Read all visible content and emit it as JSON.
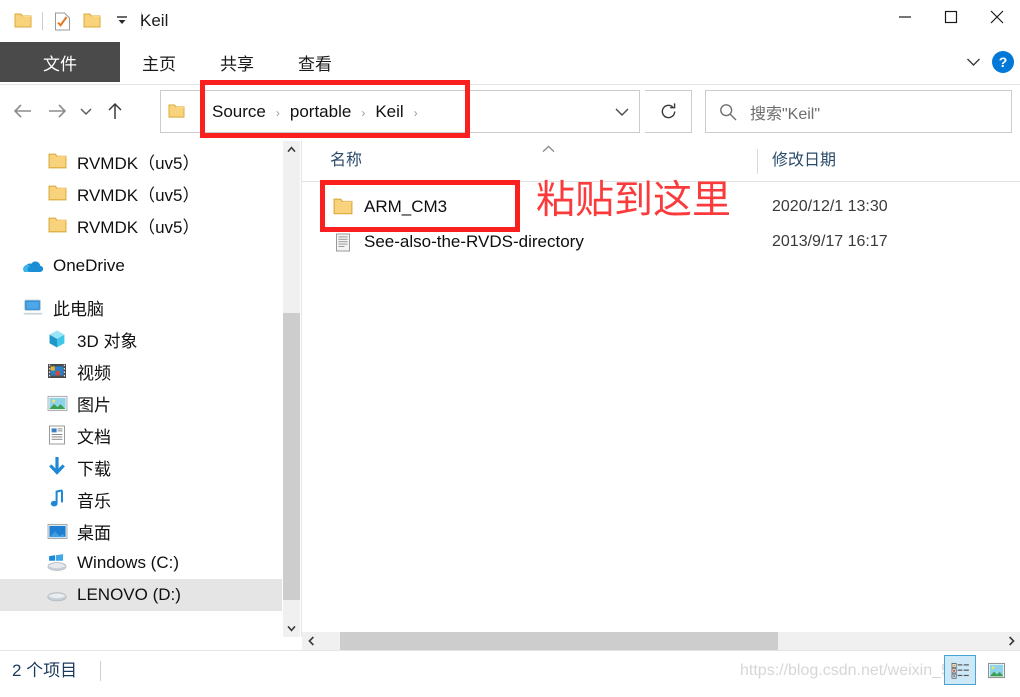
{
  "window": {
    "title": "Keil",
    "quick_access": [
      {
        "name": "folder-icon",
        "label": "文件夹"
      },
      {
        "name": "properties-icon",
        "label": "属性"
      },
      {
        "name": "new-folder-icon",
        "label": "新建文件夹"
      },
      {
        "name": "customize-dropdown-icon",
        "label": "自定义快速访问工具栏"
      }
    ],
    "controls": {
      "minimize": "最小化",
      "maximize": "最大化",
      "close": "关闭"
    }
  },
  "ribbon": {
    "tabs": [
      {
        "label": "文件",
        "active": true
      },
      {
        "label": "主页",
        "active": false
      },
      {
        "label": "共享",
        "active": false
      },
      {
        "label": "查看",
        "active": false
      }
    ],
    "expand_label": "展开功能区",
    "help_label": "?"
  },
  "navbar": {
    "back": "后退",
    "forward": "前进",
    "recent": "最近浏览的位置",
    "up": "上移到",
    "breadcrumbs": [
      "Source",
      "portable",
      "Keil"
    ],
    "breadcrumb_sep": "›",
    "dropdown": "上一个位置",
    "refresh": "刷新"
  },
  "search": {
    "placeholder": "搜索\"Keil\"",
    "icon": "search-icon"
  },
  "sidebar": {
    "items": [
      {
        "label": "RVMDK（uv5）",
        "icon": "folder-icon",
        "level": 3,
        "highlight": false
      },
      {
        "label": "RVMDK（uv5）",
        "icon": "folder-icon",
        "level": 3,
        "highlight": false
      },
      {
        "label": "RVMDK（uv5）",
        "icon": "folder-icon",
        "level": 3,
        "highlight": false
      },
      {
        "label": "OneDrive",
        "icon": "onedrive-icon",
        "level": 1,
        "highlight": false
      },
      {
        "label": "此电脑",
        "icon": "this-pc-icon",
        "level": 1,
        "highlight": false
      },
      {
        "label": "3D 对象",
        "icon": "3d-objects-icon",
        "level": 2,
        "highlight": false
      },
      {
        "label": "视频",
        "icon": "videos-icon",
        "level": 2,
        "highlight": false
      },
      {
        "label": "图片",
        "icon": "pictures-icon",
        "level": 2,
        "highlight": false
      },
      {
        "label": "文档",
        "icon": "documents-icon",
        "level": 2,
        "highlight": false
      },
      {
        "label": "下载",
        "icon": "downloads-icon",
        "level": 2,
        "highlight": false
      },
      {
        "label": "音乐",
        "icon": "music-icon",
        "level": 2,
        "highlight": false
      },
      {
        "label": "桌面",
        "icon": "desktop-icon",
        "level": 2,
        "highlight": false
      },
      {
        "label": "Windows (C:)",
        "icon": "windows-drive-icon",
        "level": 2,
        "highlight": false
      },
      {
        "label": "LENOVO (D:)",
        "icon": "drive-icon",
        "level": 2,
        "highlight": true
      }
    ]
  },
  "file_list": {
    "columns": {
      "name": "名称",
      "date": "修改日期"
    },
    "sort_caret": "⌃",
    "rows": [
      {
        "name": "ARM_CM3",
        "date": "2020/12/1 13:30",
        "icon": "folder-icon"
      },
      {
        "name": "See-also-the-RVDS-directory",
        "date": "2013/9/17 16:17",
        "icon": "file-icon"
      }
    ]
  },
  "status": {
    "item_count": "2 个项目",
    "watermark": "https://blog.csdn.net/weixin_51",
    "view_details": "详细信息视图",
    "view_large_icons": "大图标视图"
  },
  "annotations": {
    "paste_here": "粘贴到这里",
    "color": "#fb3b3b"
  }
}
